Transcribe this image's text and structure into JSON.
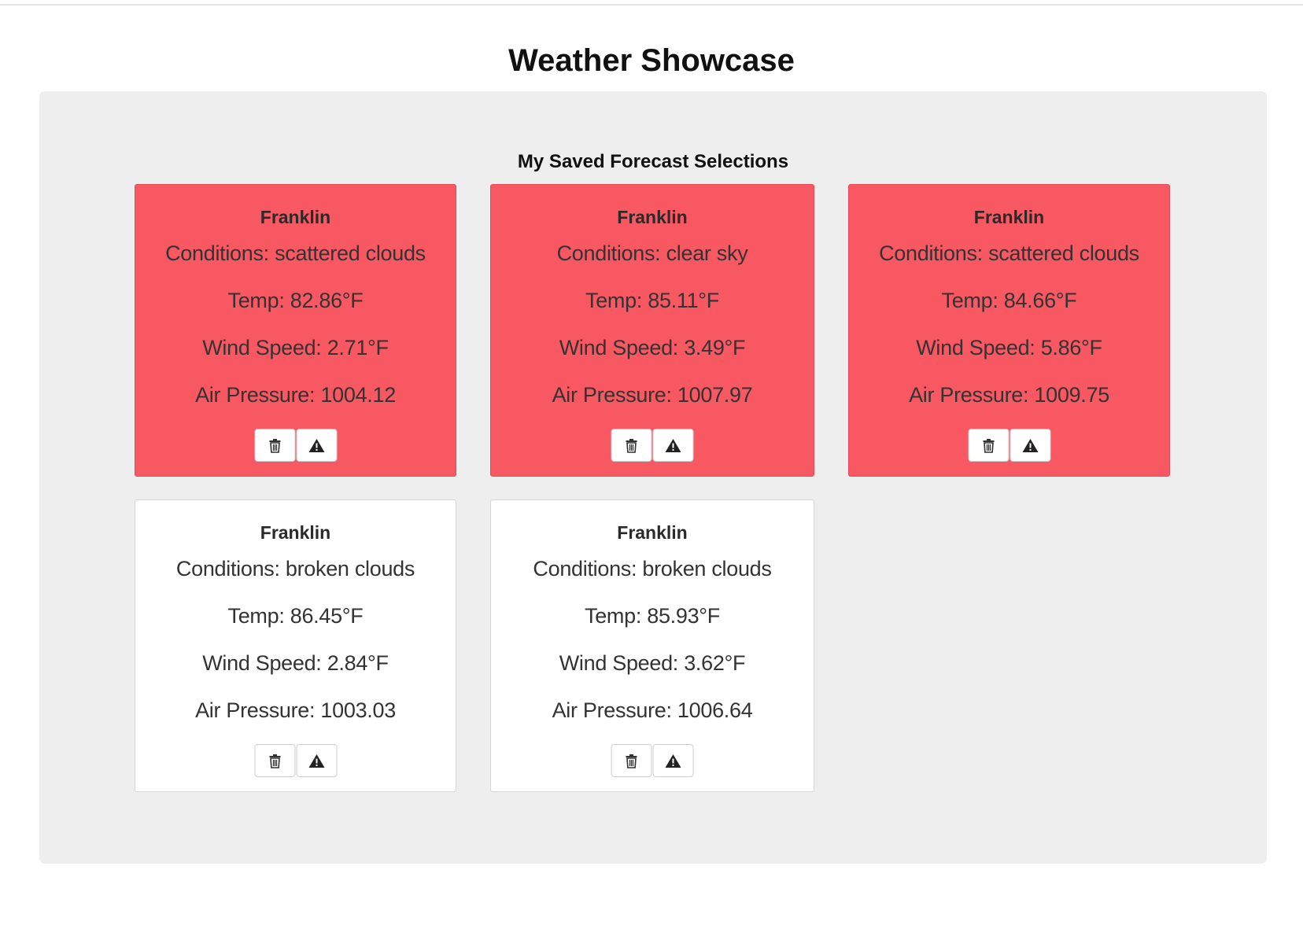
{
  "page": {
    "title": "Weather Showcase"
  },
  "saved": {
    "title": "My Saved Forecast Selections",
    "cards": [
      {
        "city": "Franklin",
        "conditions": "Conditions: scattered clouds",
        "temp": "Temp: 82.86°F",
        "wind": "Wind Speed: 2.71°F",
        "pressure": "Air Pressure: 1004.12",
        "state": "alert"
      },
      {
        "city": "Franklin",
        "conditions": "Conditions: clear sky",
        "temp": "Temp: 85.11°F",
        "wind": "Wind Speed: 3.49°F",
        "pressure": "Air Pressure: 1007.97",
        "state": "alert"
      },
      {
        "city": "Franklin",
        "conditions": "Conditions: scattered clouds",
        "temp": "Temp: 84.66°F",
        "wind": "Wind Speed: 5.86°F",
        "pressure": "Air Pressure: 1009.75",
        "state": "alert"
      },
      {
        "city": "Franklin",
        "conditions": "Conditions: broken clouds",
        "temp": "Temp: 86.45°F",
        "wind": "Wind Speed: 2.84°F",
        "pressure": "Air Pressure: 1003.03",
        "state": "normal"
      },
      {
        "city": "Franklin",
        "conditions": "Conditions: broken clouds",
        "temp": "Temp: 85.93°F",
        "wind": "Wind Speed: 3.62°F",
        "pressure": "Air Pressure: 1006.64",
        "state": "normal"
      }
    ]
  },
  "icons": {
    "delete": "trash-icon",
    "alert": "warning-icon"
  },
  "colors": {
    "alert_card": "#f75862",
    "normal_card": "#ffffff",
    "panel": "#eeeeee"
  }
}
